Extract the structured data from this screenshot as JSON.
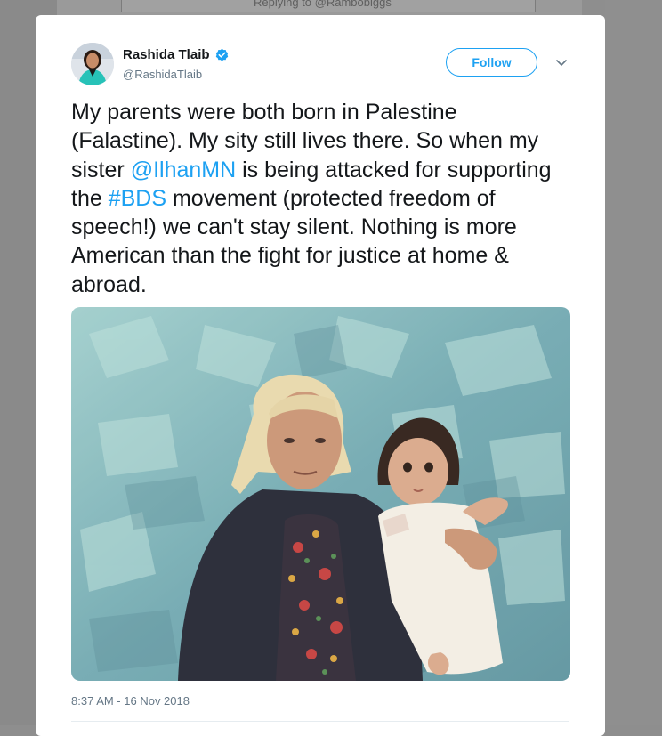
{
  "background": {
    "reply_text": "Replying to @Rambobiggs"
  },
  "tweet": {
    "author_name": "Rashida Tlaib",
    "handle": "@RashidaTlaib",
    "follow_label": "Follow",
    "text_parts": {
      "p1": "My parents were both born in Palestine (Falastine). My sity still lives there. So when my sister ",
      "mention": "@IlhanMN",
      "p2": " is being attacked for supporting the ",
      "hashtag": "#BDS",
      "p3": " movement (protected freedom of speech!) we can't stay silent. Nothing is more American than the fight for justice at home & abroad."
    },
    "timestamp": "8:37 AM - 16 Nov 2018"
  },
  "colors": {
    "accent": "#1da1f2",
    "text": "#14171a",
    "muted": "#657786"
  },
  "icons": {
    "verified": "verified-badge-icon",
    "more": "chevron-down-icon"
  }
}
